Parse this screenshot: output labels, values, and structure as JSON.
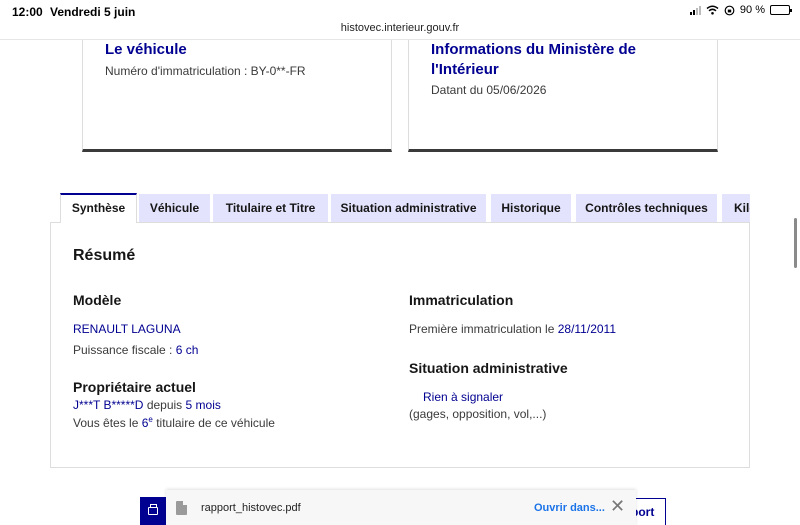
{
  "status_bar": {
    "time": "12:00",
    "date": "Vendredi 5 juin",
    "battery": "90 %",
    "battery_level": 0.9
  },
  "browser": {
    "url": "histovec.interieur.gouv.fr"
  },
  "cards": {
    "vehicle": {
      "title": "Le véhicule",
      "text": "Numéro d'immatriculation : BY-0**-FR"
    },
    "ministry": {
      "title": "Informations du Ministère de l'Intérieur",
      "text": "Datant du 05/06/2026"
    }
  },
  "tabs": [
    {
      "label": "Synthèse",
      "active": true
    },
    {
      "label": "Véhicule"
    },
    {
      "label": "Titulaire et Titre"
    },
    {
      "label": "Situation administrative"
    },
    {
      "label": "Historique"
    },
    {
      "label": "Contrôles techniques"
    },
    {
      "label": "Kilométrage"
    }
  ],
  "summary": {
    "title": "Résumé",
    "model": {
      "heading": "Modèle",
      "name": "RENAULT LAGUNA",
      "fiscal_label": "Puissance fiscale : ",
      "fiscal_value": "6 ch"
    },
    "owner": {
      "heading": "Propriétaire actuel",
      "name": "J***T B*****D",
      "since_label": " depuis ",
      "since_value": "5 mois",
      "rank_prefix": "Vous êtes le ",
      "rank_value": "6",
      "rank_sup": "e",
      "rank_suffix": " titulaire de ce véhicule"
    },
    "registration": {
      "heading": "Immatriculation",
      "first_label": "Première immatriculation le ",
      "first_date": "28/11/2011"
    },
    "admin": {
      "heading": "Situation administrative",
      "status": "Rien à signaler",
      "details": "(gages, opposition, vol,...)"
    }
  },
  "download_bar": {
    "file_name": "rapport_histovec.pdf",
    "open_in": "Ouvrir dans...",
    "close": "✕",
    "report_button": "port"
  },
  "colors": {
    "primary": "#000091",
    "tab_bg": "#e3e3fd",
    "link_blue": "#1a73e8"
  }
}
